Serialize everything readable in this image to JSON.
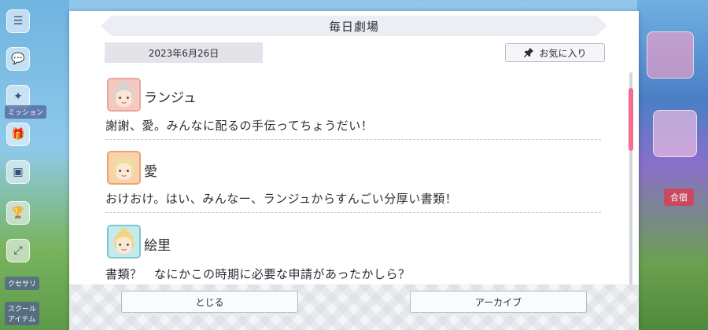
{
  "modal": {
    "title": "毎日劇場",
    "date": "2023年6月26日",
    "favorite_label": "お気に入り",
    "close_label": "とじる",
    "archive_label": "アーカイブ"
  },
  "dialog": [
    {
      "speaker": "ランジュ",
      "line": "謝謝、愛。みんなに配るの手伝ってちょうだい！",
      "avatar_icon": "lanzhu-avatar-icon"
    },
    {
      "speaker": "愛",
      "line": "おけおけ。はい、みんなー、ランジュからすんごい分厚い書類！",
      "avatar_icon": "ai-avatar-icon"
    },
    {
      "speaker": "絵里",
      "line": "書類？　なにかこの時期に必要な申請があったかしら？",
      "avatar_icon": "eli-avatar-icon"
    }
  ],
  "background": {
    "left_labels": [
      "ミッション",
      "クセサリ",
      "スクール\nアイテム"
    ],
    "right_labels": [
      "合宿"
    ]
  },
  "colors": {
    "accent_scroll": "#f46d8f",
    "modal_bg": "#ffffff",
    "title_bar": "#eceef3"
  }
}
